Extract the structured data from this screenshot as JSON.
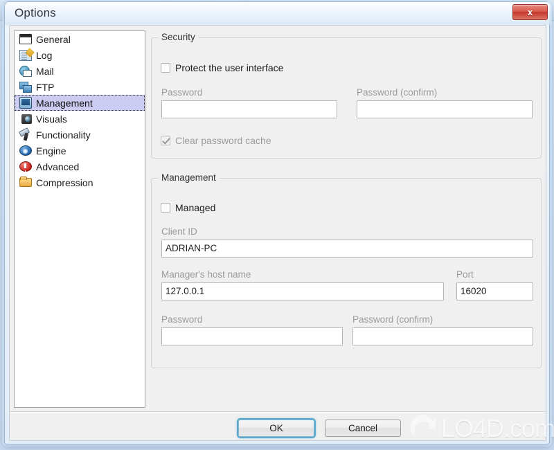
{
  "window": {
    "title": "Options",
    "close_label": "x",
    "close_icon": "close-icon"
  },
  "backdrop": {
    "icons": [
      "add-icon",
      "refresh-icon",
      "alert-icon",
      "green-shape-icon",
      "globe-icon"
    ]
  },
  "sidebar": {
    "items": [
      {
        "label": "General",
        "icon": "window-icon"
      },
      {
        "label": "Log",
        "icon": "notepad-pencil-icon"
      },
      {
        "label": "Mail",
        "icon": "mail-globe-icon"
      },
      {
        "label": "FTP",
        "icon": "two-monitors-icon"
      },
      {
        "label": "Management",
        "icon": "device-screen-icon",
        "selected": true
      },
      {
        "label": "Visuals",
        "icon": "camera-icon"
      },
      {
        "label": "Functionality",
        "icon": "wrench-hammer-icon"
      },
      {
        "label": "Engine",
        "icon": "gear-icon"
      },
      {
        "label": "Advanced",
        "icon": "exclamation-circle-icon"
      },
      {
        "label": "Compression",
        "icon": "folder-icon"
      }
    ]
  },
  "security_group": {
    "title": "Security",
    "protect_ui": {
      "label": "Protect the user interface",
      "checked": false,
      "enabled": true
    },
    "password": {
      "label": "Password",
      "value": "",
      "enabled": false
    },
    "password_confirm": {
      "label": "Password (confirm)",
      "value": "",
      "enabled": false
    },
    "clear_cache": {
      "label": "Clear password cache",
      "checked": true,
      "enabled": false
    }
  },
  "management_group": {
    "title": "Management",
    "managed": {
      "label": "Managed",
      "checked": false,
      "enabled": true
    },
    "client_id": {
      "label": "Client ID",
      "value": "ADRIAN-PC",
      "enabled": false
    },
    "host_name": {
      "label": "Manager's host name",
      "value": "127.0.0.1",
      "enabled": false
    },
    "port": {
      "label": "Port",
      "value": "16020",
      "enabled": false
    },
    "password": {
      "label": "Password",
      "value": "",
      "enabled": false
    },
    "password_confirm": {
      "label": "Password (confirm)",
      "value": "",
      "enabled": false
    }
  },
  "footer": {
    "ok_label": "OK",
    "cancel_label": "Cancel"
  },
  "watermark": {
    "text": "LO4D.com",
    "logo_icon": "circular-arrows-icon"
  },
  "colors": {
    "selection": "#ccccf2",
    "close_button": "#c2372b",
    "focus_ring": "#5aa8cc",
    "dialog_face": "#f0f0f0",
    "disabled_text": "#9b9b9b"
  }
}
